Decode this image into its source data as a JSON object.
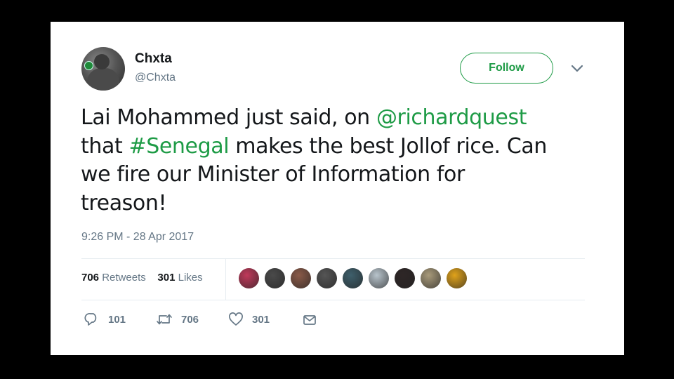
{
  "tweet": {
    "author": {
      "name": "Chxta",
      "handle": "@Chxta"
    },
    "follow_label": "Follow",
    "text": {
      "line1_a": "Lai Mohammed just said, on ",
      "mention": "@richardquest",
      "line2_a": "that ",
      "hashtag": "#Senegal",
      "line2_b": " makes the best Jollof rice. Can",
      "line3": "we fire our Minister of Information for",
      "line4": "treason!"
    },
    "timestamp": "9:26 PM - 28 Apr 2017",
    "stats": {
      "retweets_count": "706",
      "retweets_label": "Retweets",
      "likes_count": "301",
      "likes_label": "Likes"
    },
    "liker_avatars": [
      {
        "name": "liker-1",
        "color": "#c0395a"
      },
      {
        "name": "liker-2",
        "color": "#4a4a4a"
      },
      {
        "name": "liker-3",
        "color": "#8a5a48"
      },
      {
        "name": "liker-4",
        "color": "#555555"
      },
      {
        "name": "liker-5",
        "color": "#3e5f6b"
      },
      {
        "name": "liker-6",
        "color": "#b8c4cc"
      },
      {
        "name": "liker-7",
        "color": "#2e2626"
      },
      {
        "name": "liker-8",
        "color": "#a89a7a"
      },
      {
        "name": "liker-9",
        "color": "#e0a21a"
      }
    ],
    "actions": {
      "replies": "101",
      "retweets": "706",
      "likes": "301"
    }
  },
  "colors": {
    "accent": "#1e9b46",
    "muted": "#657786",
    "text": "#14171a"
  },
  "icons": [
    "reply-icon",
    "retweet-icon",
    "heart-icon",
    "message-icon",
    "chevron-down-icon"
  ]
}
